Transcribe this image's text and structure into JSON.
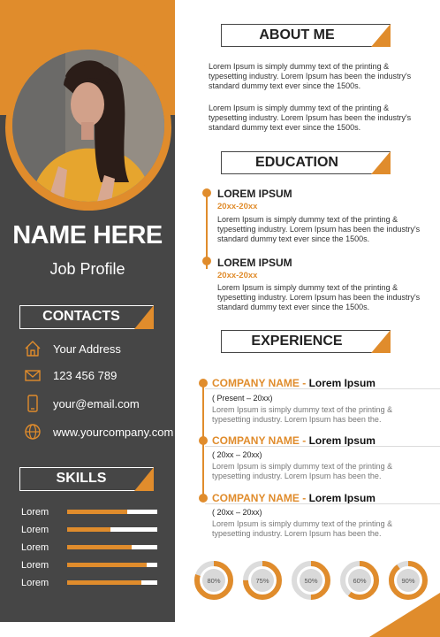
{
  "colors": {
    "accent": "#e08c2c",
    "dark": "#464646"
  },
  "profile": {
    "name": "NAME HERE",
    "job_profile": "Job Profile"
  },
  "contacts": {
    "title": "CONTACTS",
    "items": [
      {
        "icon": "home-icon",
        "text": "Your Address"
      },
      {
        "icon": "envelope-icon",
        "text": "123 456 789"
      },
      {
        "icon": "phone-icon",
        "text": "your@email.com"
      },
      {
        "icon": "globe-icon",
        "text": "www.yourcompany.com"
      }
    ]
  },
  "skills": {
    "title": "SKILLS",
    "items": [
      {
        "label": "Lorem",
        "level": 0.67
      },
      {
        "label": "Lorem",
        "level": 0.48
      },
      {
        "label": "Lorem",
        "level": 0.72
      },
      {
        "label": "Lorem",
        "level": 0.88
      },
      {
        "label": "Lorem",
        "level": 0.82
      }
    ]
  },
  "about": {
    "title": "ABOUT ME",
    "paragraphs": [
      "Lorem Ipsum is simply dummy text of the printing & typesetting industry. Lorem Ipsum has been the industry's standard dummy text ever since the 1500s.",
      "Lorem Ipsum is simply dummy text of the printing & typesetting industry. Lorem Ipsum has been the industry's standard dummy text ever since the 1500s."
    ]
  },
  "education": {
    "title": "EDUCATION",
    "items": [
      {
        "heading": "LOREM IPSUM",
        "years": "20xx-20xx",
        "text": "Lorem Ipsum is simply dummy text of the printing & typesetting industry. Lorem Ipsum has been the industry's standard dummy text ever since the 1500s."
      },
      {
        "heading": "LOREM IPSUM",
        "years": "20xx-20xx",
        "text": "Lorem Ipsum is simply dummy text of the printing & typesetting industry. Lorem Ipsum has been the industry's standard dummy text ever since the 1500s."
      }
    ]
  },
  "experience": {
    "title": "EXPERIENCE",
    "items": [
      {
        "company": "COMPANY NAME",
        "dash": "-",
        "role": "Lorem Ipsum",
        "period": "( Present – 20xx)",
        "text": "Lorem Ipsum is simply dummy text of the printing & typesetting industry. Lorem Ipsum has been the."
      },
      {
        "company": "COMPANY NAME",
        "dash": "-",
        "role": "Lorem Ipsum",
        "period": "( 20xx – 20xx)",
        "text": "Lorem Ipsum is simply dummy text of the printing & typesetting industry. Lorem Ipsum has been the."
      },
      {
        "company": "COMPANY NAME",
        "dash": "-",
        "role": "Lorem Ipsum",
        "period": "( 20xx – 20xx)",
        "text": "Lorem Ipsum is simply dummy text of the printing & typesetting industry. Lorem Ipsum has been the."
      }
    ]
  },
  "progress_rings": [
    {
      "label": "80%",
      "value": 80
    },
    {
      "label": "75%",
      "value": 75
    },
    {
      "label": "50%",
      "value": 50
    },
    {
      "label": "60%",
      "value": 60
    },
    {
      "label": "90%",
      "value": 90
    }
  ]
}
